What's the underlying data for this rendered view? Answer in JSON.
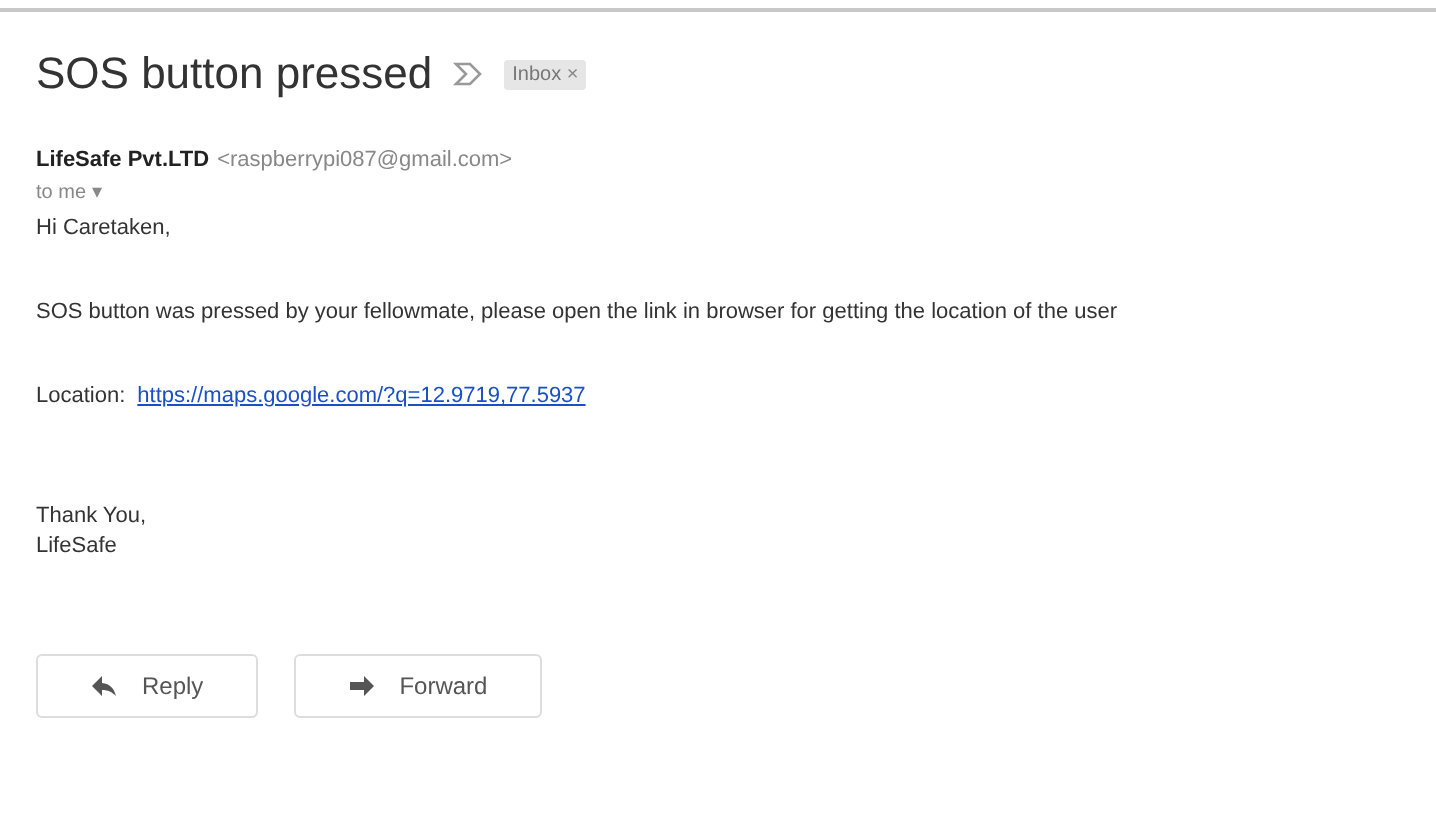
{
  "subject": "SOS button pressed",
  "label": {
    "text": "Inbox",
    "remove": "×"
  },
  "sender": {
    "name": "LifeSafe Pvt.LTD",
    "email": "<raspberrypi087@gmail.com>"
  },
  "recipient": {
    "text": "to me",
    "caret": "▾"
  },
  "body": {
    "greeting": "Hi Caretaken,",
    "message": "SOS button was pressed by your fellowmate, please open the link in browser for getting the location of the user",
    "location_label": "Location:",
    "location_link": "https://maps.google.com/?q=12.9719,77.5937",
    "closing": [
      "Thank You,",
      "LifeSafe"
    ]
  },
  "buttons": [
    {
      "kind": "reply",
      "label": "Reply"
    },
    {
      "kind": "forward",
      "label": "Forward"
    }
  ]
}
